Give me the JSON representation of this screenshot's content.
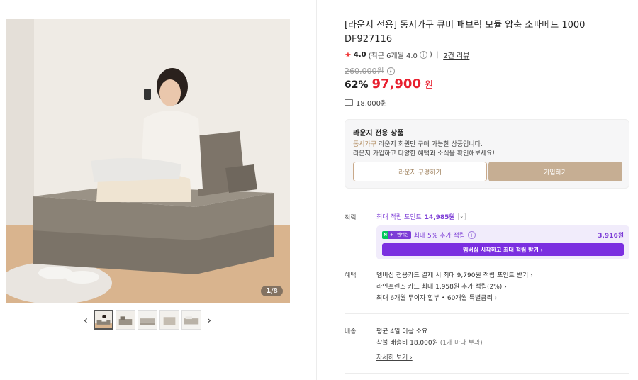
{
  "gallery": {
    "counter_current": "1",
    "counter_total": "/8",
    "prev_label": "‹",
    "next_label": "›"
  },
  "product": {
    "title": "[라운지 전용] 동서가구 큐비 패브릭 모듈 압축 소파베드 1000 DF927116",
    "rating_score": "4.0",
    "rating_detail": "(최근 6개월 4.0",
    "rating_detail_end": ")",
    "review_link": "2건 리뷰",
    "original_price": "260,000원",
    "discount": "62%",
    "sale_price": "97,900",
    "sale_unit": "원",
    "shipping_fee": "18,000원"
  },
  "lounge": {
    "title": "라운지 전용 상품",
    "desc1_brand": "동서가구",
    "desc1_rest": " 라운지 회원만 구매 가능한 상품입니다.",
    "desc2": "라운지 가입하고 다양한 혜택과 소식을 확인해보세요!",
    "look_button": "라운지 구경하기",
    "join_button": "가입하기"
  },
  "points": {
    "label": "적립",
    "max_text": "최대 적립 포인트",
    "max_value": "14,985원",
    "npay_badge_n": "N",
    "npay_badge_plus": "+",
    "npay_badge_member": "멤버십",
    "npay_text": "최대 5% 추가 적립",
    "npay_amount": "3,916원",
    "npay_button": "멤버십 시작하고 최대 적립 받기 ›"
  },
  "benefits": {
    "label": "혜택",
    "items": [
      "멤버십 전용카드 결제 시 최대 9,790원 적립 포인트 받기 ›",
      "라인프렌즈 카드 최대 1,958원 추가 적립(2%) ›",
      "최대 6개월 무이자 할부 • 60개월 특별금리 ›"
    ]
  },
  "delivery": {
    "label": "배송",
    "line1": "평균 4일 이상 소요",
    "line2_main": "착불 배송비 18,000원",
    "line2_sub": " (1개 마다 부과)",
    "detail_link": "자세히 보기 ›"
  },
  "colors": {
    "sale_red": "#e8202f",
    "star_red": "#f03a3a",
    "lounge_beige": "#c6ae93",
    "npay_purple": "#7b2fe0",
    "naver_green": "#03c75a"
  }
}
